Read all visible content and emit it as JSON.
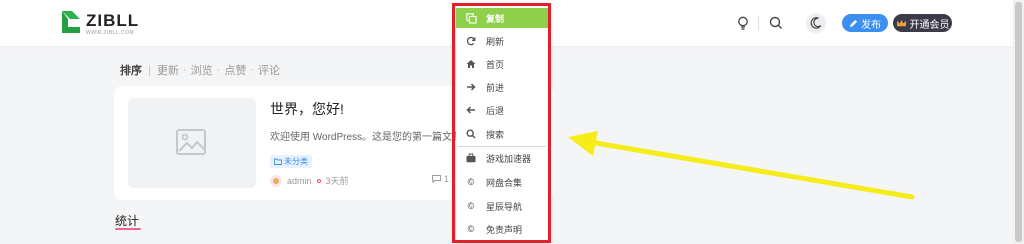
{
  "header": {
    "logo_text": "ZIBLL",
    "logo_tagline": "WWW.ZIBLL.COM",
    "publish_label": "发布",
    "vip_label": "开通会员",
    "colors": {
      "publish": "#3b8ff0",
      "vip": "#3a3a48"
    },
    "icons": [
      "bulb-icon",
      "search-icon",
      "moon-icon"
    ]
  },
  "sortbar": {
    "label": "排序",
    "options": [
      "更新",
      "浏览",
      "点赞",
      "评论"
    ]
  },
  "post": {
    "title": "世界，您好!",
    "excerpt": "欢迎使用 WordPress。这是您的第一篇文章。",
    "category": "未分类",
    "author": "admin",
    "time": "3天前",
    "comments": "1"
  },
  "section": {
    "title": "统计"
  },
  "context_menu": {
    "highlight_color": "#8fd04a",
    "outline_color": "#e0202a",
    "items": [
      {
        "label": "复制",
        "icon": "copy-icon"
      },
      {
        "label": "刷新",
        "icon": "refresh-icon"
      },
      {
        "label": "首页",
        "icon": "home-icon"
      },
      {
        "label": "前进",
        "icon": "arrow-right-icon"
      },
      {
        "label": "后退",
        "icon": "arrow-left-icon"
      },
      {
        "label": "搜索",
        "icon": "search-icon"
      },
      {
        "label": "游戏加速器",
        "icon": "briefcase-icon"
      },
      {
        "label": "网盘合集",
        "icon": "copyright-icon"
      },
      {
        "label": "星辰导航",
        "icon": "copyright-icon"
      },
      {
        "label": "免责声明",
        "icon": "copyright-icon"
      }
    ]
  },
  "annotation": {
    "arrow_color": "#f5ec1a"
  }
}
